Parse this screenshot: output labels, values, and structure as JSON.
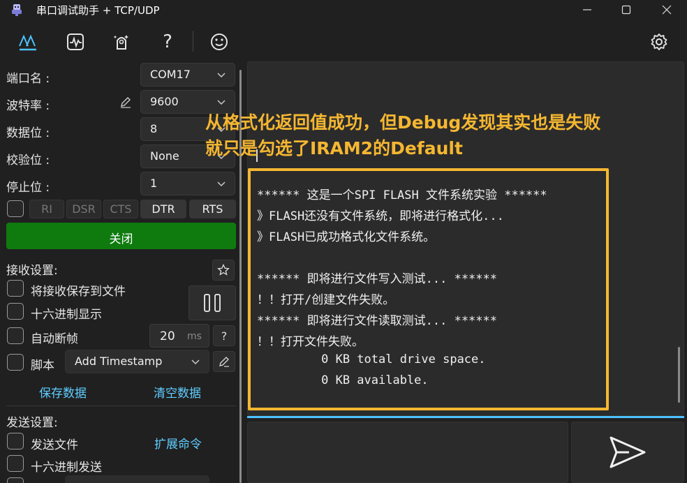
{
  "window": {
    "title": "串口调试助手 + TCP/UDP",
    "minimize_icon": "minimize-icon",
    "maximize_icon": "maximize-icon",
    "close_icon": "close-icon"
  },
  "toolbar": {
    "items": [
      "serial-wave-icon",
      "monitor-icon",
      "rocket-icon",
      "help-icon",
      "smiley-icon",
      "settings-icon"
    ],
    "help_label": "?"
  },
  "serial": {
    "port_label": "端口名 :",
    "port_value": "COM17",
    "baud_label": "波特率 :",
    "baud_value": "9600",
    "databits_label": "数据位 :",
    "databits_value": "8",
    "parity_label": "校验位 :",
    "parity_value": "None",
    "stopbits_label": "停止位 :",
    "stopbits_value": "1",
    "pins": [
      "RI",
      "DSR",
      "CTS",
      "DTR",
      "RTS"
    ],
    "close_button": "关闭"
  },
  "receive": {
    "header": "接收设置:",
    "save_to_file": "将接收保存到文件",
    "hex_display": "十六进制显示",
    "auto_frame": "自动断帧",
    "frame_ms_value": "20",
    "frame_ms_unit": "ms",
    "frame_help": "?",
    "script_label": "脚本",
    "script_value": "Add Timestamp",
    "save_data": "保存数据",
    "clear_data": "清空数据"
  },
  "send": {
    "header": "发送设置:",
    "send_file": "发送文件",
    "extend_command": "扩展命令",
    "hex_send": "十六进制发送"
  },
  "annotation": {
    "line1": "从格式化返回值成功，但Debug发现其实也是失败",
    "line2": "就只是勾选了IRAM2的Default",
    "color": "#f5b731"
  },
  "log": {
    "lines": [
      "****** 这是一个SPI FLASH 文件系统实验 ******",
      "》FLASH还没有文件系统，即将进行格式化...",
      "》FLASH已成功格式化文件系统。",
      "",
      "****** 即将进行文件写入测试... ******",
      "！！打开/创建文件失败。",
      "****** 即将进行文件读取测试... ******",
      "！！打开文件失败。",
      "         0 KB total drive space.",
      "         0 KB available."
    ]
  },
  "colors": {
    "accent": "#4cc2ff",
    "link": "#60cdff",
    "close_button": "#0f7b0f",
    "background": "#202020"
  }
}
